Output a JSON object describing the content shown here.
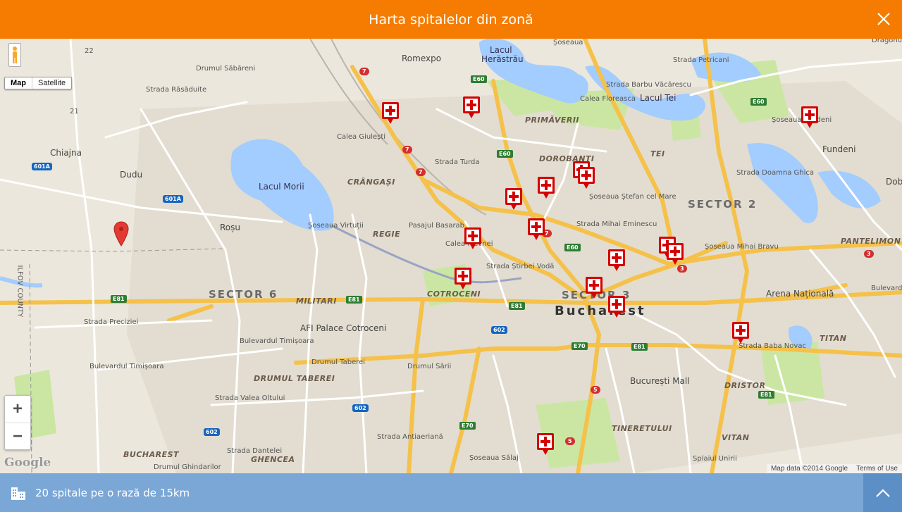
{
  "header": {
    "title": "Harta spitalelor din zonă",
    "close_icon": "close-icon"
  },
  "map": {
    "map_type": {
      "map_label": "Map",
      "satellite_label": "Satellite",
      "selected": "Map"
    },
    "zoom": {
      "in_label": "+",
      "out_label": "−"
    },
    "logo": "Google",
    "attribution": {
      "data": "Map data ©2014 Google",
      "terms": "Terms of Use"
    },
    "labels": {
      "romexpo": "Romexpo",
      "lacul_herastrau_1": "Lacul",
      "lacul_herastrau_2": "Herăstrău",
      "soseaua": "Șoseaua",
      "dragonul": "Dragonul",
      "lacul_tei": "Lacul Tei",
      "primaverii": "PRIMĂVERII",
      "dorobanti": "DOROBANȚI",
      "tei": "TEI",
      "fundeni": "Fundeni",
      "dob": "Dob",
      "chiajna": "Chiajna",
      "dudu": "Dudu",
      "lacul_morii": "Lacul Morii",
      "crangasi": "CRÂNGAȘI",
      "rosu": "Roșu",
      "regie": "REGIE",
      "sector2": "SECTOR 2",
      "pantelimon": "PANTELIMON",
      "sector6": "SECTOR 6",
      "militari": "MILITARI",
      "cotroceni": "COTROCENI",
      "sector3": "SECTOR 3",
      "bucharest": "Bucharest",
      "arena": "Arena Națională",
      "afi": "AFI Palace Cotroceni",
      "drumul_taberei": "DRUMUL TABEREI",
      "titan": "TITAN",
      "dristor": "DRISTOR",
      "bucuresti_mall": "București Mall",
      "tineretului": "TINERETULUI",
      "vitan": "VITAN",
      "ghencea": "GHENCEA",
      "bucharest_sw": "BUCHAREST",
      "ilfov": "ILFOV COUNTY",
      "str_preciziei": "Strada Preciziei",
      "bd_timisoara": "Bulevardul Timișoara",
      "bd_timisoara2": "Bulevardul Timișoara",
      "drumul_taberei_rd": "Drumul Taberei",
      "str_stirbei": "Strada Știrbei Vodă",
      "str_mihai": "Strada Mihai Eminescu",
      "sos_stefan": "Șoseaua Ștefan cel Mare",
      "sos_fundeni": "Șoseaua Fundeni",
      "str_doamna": "Strada Doamna Ghica",
      "str_baba": "Strada Baba Novac",
      "splaiul": "Splaiul Unirii",
      "str_turda": "Strada Turda",
      "calea_giulesti": "Calea Giulești",
      "bulevard": "Bulevard",
      "sos_virtutii": "Șoseaua Virtuții",
      "drumul_sabareni": "Drumul Săbăreni",
      "str_rasaduite": "Strada Răsăduite",
      "pasajul": "Pasajul Basarab",
      "calea_plevnei": "Calea Plevnei",
      "str_valea_oltului": "Strada Valea Oltului",
      "drumul_sarii": "Drumul Sării",
      "str_antiaeriana": "Strada Antiaeriană",
      "str_dantelei": "Strada Dantelei",
      "drumul_ghindarilor": "Drumul Ghindarilor",
      "sos_salaj": "Șoseaua Sălaj",
      "str_barbu": "Strada Barbu Văcărescu",
      "calea_floreasca": "Calea Floreasca",
      "str_petricani": "Strada Petricani",
      "sos_mihai_bravu": "Șoseaua Mihai Bravu"
    },
    "road_shields": {
      "e60_a": "E60",
      "e60_b": "E60",
      "e60_c": "E60",
      "e60_d": "E60",
      "e81_a": "E81",
      "e81_b": "E81",
      "e81_c": "E81",
      "e81_d": "E81",
      "e81_e": "E81",
      "e70_a": "E70",
      "e70_b": "E70",
      "r601a_a": "601A",
      "r601a_b": "601A",
      "r602_a": "602",
      "r602_b": "602",
      "r602_c": "602",
      "r7_a": "7",
      "r7_b": "7",
      "r7_c": "7",
      "r7_d": "7",
      "r3_a": "3",
      "r3_b": "3",
      "r5_a": "5",
      "r5_b": "5",
      "r21": "21",
      "r22": "22"
    },
    "hospital_markers_icon": "hospital-cross-icon",
    "current_location_icon": "location-pin-icon"
  },
  "footer": {
    "summary": "20 spitale pe o rază de 15km",
    "icon": "building-icon",
    "expand_icon": "chevron-up-icon"
  },
  "colors": {
    "header": "#f57c00",
    "footer": "#7ba7d6",
    "footer_button": "#5d8fc7",
    "marker": "#d50000",
    "water": "#a3ccff",
    "park": "#cbe6a3",
    "highway": "#ffd54f"
  }
}
